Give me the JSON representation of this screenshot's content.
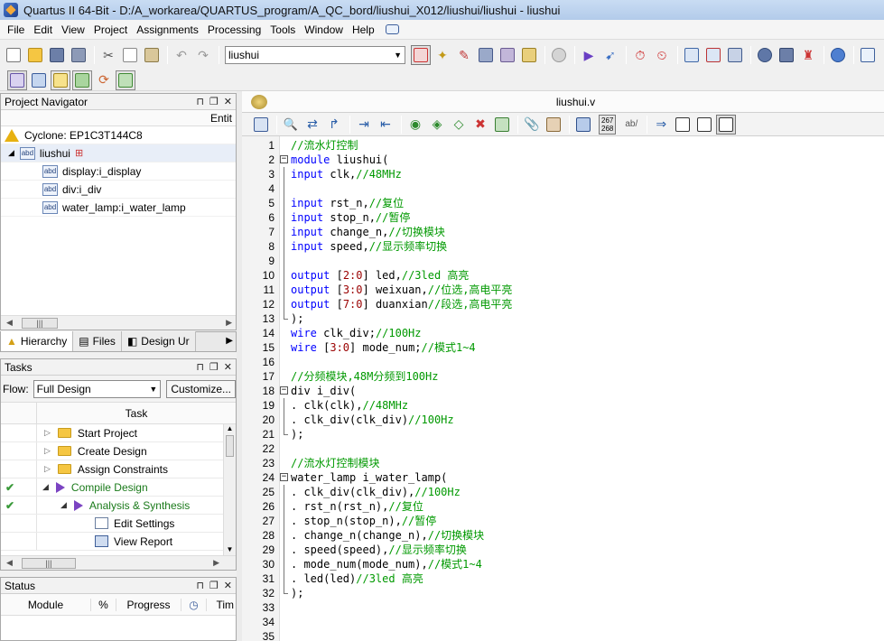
{
  "window": {
    "title": "Quartus II 64-Bit - D:/A_workarea/QUARTUS_program/A_QC_bord/liushui_X012/liushui/liushui - liushui"
  },
  "menu": [
    "File",
    "Edit",
    "View",
    "Project",
    "Assignments",
    "Processing",
    "Tools",
    "Window",
    "Help"
  ],
  "toolbar": {
    "entity_combo": "liushui"
  },
  "project_navigator": {
    "title": "Project Navigator",
    "column": "Entit",
    "device": "Cyclone: EP1C3T144C8",
    "top": "liushui",
    "children": [
      "display:i_display",
      "div:i_div",
      "water_lamp:i_water_lamp"
    ],
    "tabs": [
      "Hierarchy",
      "Files",
      "Design Ur"
    ]
  },
  "tasks": {
    "title": "Tasks",
    "flow_label": "Flow:",
    "flow_value": "Full Design",
    "customize": "Customize...",
    "column": "Task",
    "items": [
      "Start Project",
      "Create Design",
      "Assign Constraints",
      "Compile Design",
      "Analysis & Synthesis",
      "Edit Settings",
      "View Report"
    ]
  },
  "status": {
    "title": "Status",
    "columns": [
      "Module",
      "%",
      "Progress",
      "Tim"
    ]
  },
  "editor": {
    "tab": "liushui.v",
    "counter_top": "267",
    "counter_bottom": "268",
    "ab": "ab/",
    "lines": [
      "1",
      "2",
      "3",
      "4",
      "5",
      "6",
      "7",
      "8",
      "9",
      "10",
      "11",
      "12",
      "13",
      "14",
      "15",
      "16",
      "17",
      "18",
      "19",
      "20",
      "21",
      "22",
      "23",
      "24",
      "25",
      "26",
      "27",
      "28",
      "29",
      "30",
      "31",
      "32",
      "33",
      "34",
      "35"
    ],
    "code": {
      "l1": "//流水灯控制",
      "l2a": "module",
      "l2b": " liushui(",
      "l3a": "input",
      "l3b": " clk,",
      "l3c": "//48MHz",
      "l5a": "input",
      "l5b": " rst_n,",
      "l5c": "//复位",
      "l6a": "input",
      "l6b": " stop_n,",
      "l6c": "//暂停",
      "l7a": "input",
      "l7b": " change_n,",
      "l7c": "//切换模块",
      "l8a": "input",
      "l8b": " speed,",
      "l8c": "//显示频率切换",
      "l10a": "output",
      "l10b": " [",
      "l10c": "2:0",
      "l10d": "] led,",
      "l10e": "//3led 高亮",
      "l11a": "output",
      "l11b": " [",
      "l11c": "3:0",
      "l11d": "] weixuan,",
      "l11e": "//位选,高电平亮",
      "l12a": "output",
      "l12b": " [",
      "l12c": "7:0",
      "l12d": "] duanxian",
      "l12e": "//段选,高电平亮",
      "l13": ");",
      "l14a": "wire",
      "l14b": " clk_div;",
      "l14c": "//100Hz",
      "l15a": "wire",
      "l15b": " [",
      "l15c": "3:0",
      "l15d": "] mode_num;",
      "l15e": "//模式1~4",
      "l17": "//分频模块,48M分频到100Hz",
      "l18": "div i_div(",
      "l19a": ". clk(clk),",
      "l19b": "//48MHz",
      "l20a": ". clk_div(clk_div)",
      "l20b": "//100Hz",
      "l21": ");",
      "l23": "//流水灯控制模块",
      "l24": "water_lamp i_water_lamp(",
      "l25a": ". clk_div(clk_div),",
      "l25b": "//100Hz",
      "l26a": ". rst_n(rst_n),",
      "l26b": "//复位",
      "l27a": ". stop_n(stop_n),",
      "l27b": "//暂停",
      "l28a": ". change_n(change_n),",
      "l28b": "//切换模块",
      "l29a": ". speed(speed),",
      "l29b": "//显示频率切换",
      "l30a": ". mode_num(mode_num),",
      "l30b": "//模式1~4",
      "l31a": ". led(led)",
      "l31b": "//3led 高亮",
      "l32": ");"
    }
  }
}
